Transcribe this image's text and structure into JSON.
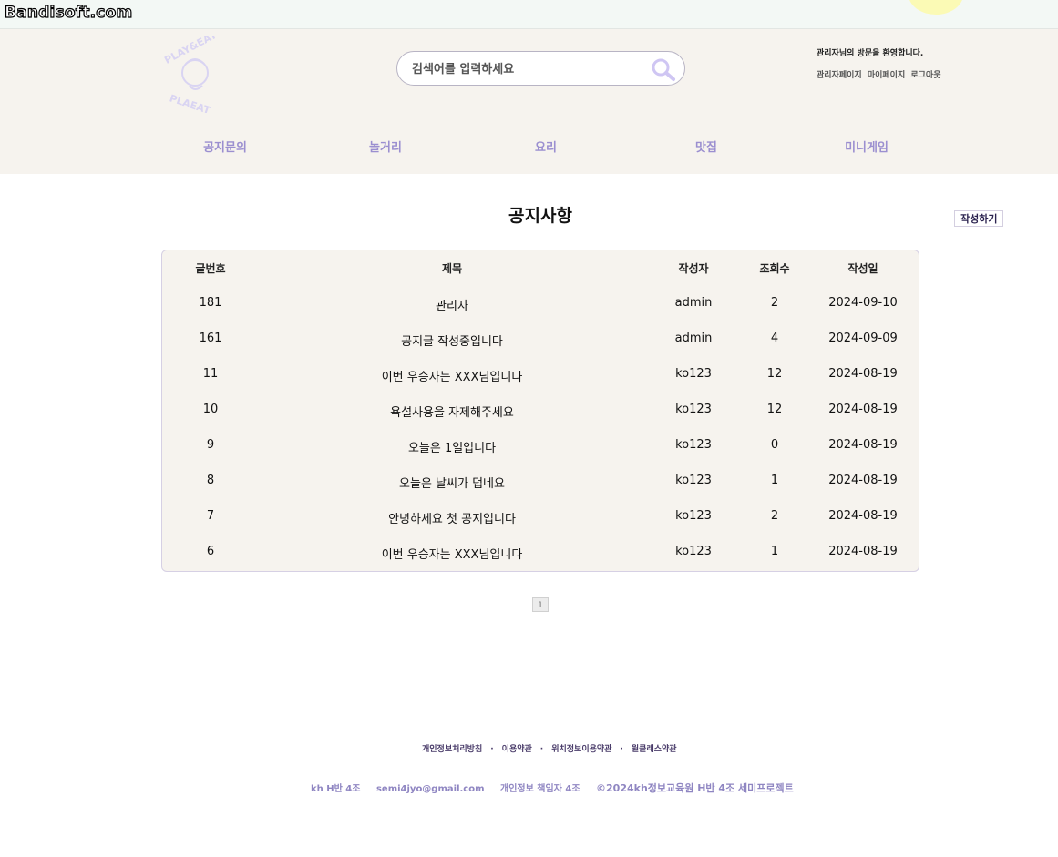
{
  "watermark": "Bandisoft.com",
  "header": {
    "search_placeholder": "검색어를 입력하세요",
    "welcome": "관리자님의 방문을 환영합니다.",
    "links": [
      "관리자페이지",
      "마이페이지",
      "로그아웃"
    ]
  },
  "nav": [
    "공지문의",
    "놀거리",
    "요리",
    "맛집",
    "미니게임"
  ],
  "page": {
    "title": "공지사항",
    "write_button": "작성하기"
  },
  "table": {
    "columns": [
      "글번호",
      "제목",
      "작성자",
      "조회수",
      "작성일"
    ],
    "rows": [
      [
        "181",
        "관리자",
        "admin",
        "2",
        "2024-09-10"
      ],
      [
        "161",
        "공지글 작성중입니다",
        "admin",
        "4",
        "2024-09-09"
      ],
      [
        "11",
        "이번 우승자는 XXX님입니다",
        "ko123",
        "12",
        "2024-08-19"
      ],
      [
        "10",
        "욕설사용을 자제해주세요",
        "ko123",
        "12",
        "2024-08-19"
      ],
      [
        "9",
        "오늘은 1일입니다",
        "ko123",
        "0",
        "2024-08-19"
      ],
      [
        "8",
        "오늘은 날씨가 덥네요",
        "ko123",
        "1",
        "2024-08-19"
      ],
      [
        "7",
        "안녕하세요 첫 공지입니다",
        "ko123",
        "2",
        "2024-08-19"
      ],
      [
        "6",
        "이번 우승자는 XXX님입니다",
        "ko123",
        "1",
        "2024-08-19"
      ]
    ]
  },
  "pagination": {
    "current": "1"
  },
  "footer": {
    "links": [
      "개인정보처리방침",
      "이용약관",
      "위치정보이용약관",
      "윌클래스약관"
    ],
    "separator": "·",
    "info": [
      "kh H반 4조",
      "semi4jyo@gmail.com",
      "개인정보 책임자 4조",
      "©2024kh정보교육원 H반 4조 세미프로젝트"
    ]
  },
  "colors": {
    "header_bg": "#f6f3ee",
    "accent": "#9b8fd0",
    "logo": "#d9d4f2",
    "footer_link": "#4a3c6a"
  }
}
